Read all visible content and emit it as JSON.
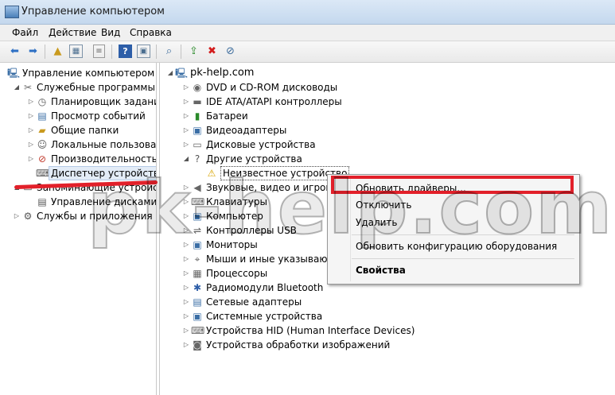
{
  "window": {
    "title": "Управление компьютером",
    "accent": "#c4d8ee"
  },
  "menu": {
    "items": [
      "Файл",
      "Действие",
      "Вид",
      "Справка"
    ]
  },
  "toolbar": {
    "icons": [
      "back-arrow-icon",
      "forward-arrow-icon",
      "up-folder-icon",
      "show-hide-tree-icon",
      "properties-icon",
      "help-icon",
      "view-icon",
      "scan-hardware-icon",
      "update-driver-icon",
      "uninstall-icon",
      "disable-icon"
    ]
  },
  "left_tree": {
    "items": [
      {
        "label": "Управление компьютером (л",
        "icon": "computer-management-icon"
      },
      {
        "label": "Служебные программы",
        "icon": "tools-icon"
      },
      {
        "label": "Планировщик заданий",
        "icon": "clock-icon"
      },
      {
        "label": "Просмотр событий",
        "icon": "event-viewer-icon"
      },
      {
        "label": "Общие папки",
        "icon": "shared-folder-icon"
      },
      {
        "label": "Локальные пользовате",
        "icon": "users-icon"
      },
      {
        "label": "Производительность",
        "icon": "performance-icon"
      },
      {
        "label": "Диспетчер устройств",
        "icon": "device-manager-icon"
      },
      {
        "label": "Запоминающие устройст",
        "icon": "storage-icon"
      },
      {
        "label": "Управление дисками",
        "icon": "disk-management-icon"
      },
      {
        "label": "Службы и приложения",
        "icon": "services-icon"
      }
    ]
  },
  "device_tree": {
    "root": "pk-help.com",
    "items": [
      "DVD и CD-ROM дисководы",
      "IDE ATA/ATAPI контроллеры",
      "Батареи",
      "Видеоадаптеры",
      "Дисковые устройства",
      "Другие устройства",
      "Неизвестное устройство",
      "Звуковые, видео и игровые",
      "Клавиатуры",
      "Компьютер",
      "Контроллеры USB",
      "Мониторы",
      "Мыши и иные указывающ",
      "Процессоры",
      "Радиомодули Bluetooth",
      "Сетевые адаптеры",
      "Системные устройства",
      "Устройства HID (Human Interface Devices)",
      "Устройства обработки изображений"
    ]
  },
  "context_menu": {
    "items": [
      "Обновить драйверы...",
      "Отключить",
      "Удалить",
      "Обновить конфигурацию оборудования",
      "Свойства"
    ]
  },
  "highlight_color": "#e2202a",
  "watermark": "pk-help.com"
}
